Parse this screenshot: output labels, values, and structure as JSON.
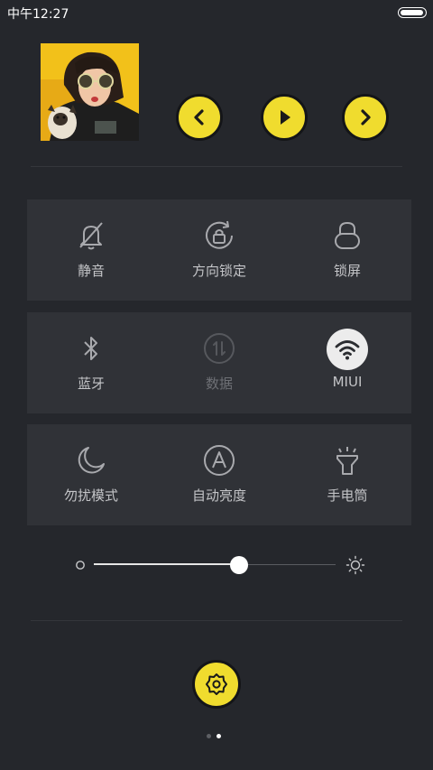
{
  "status_bar": {
    "time": "中午12:27",
    "battery_level": 1.0
  },
  "media": {
    "album_art": "album-cover-photo",
    "controls": [
      "previous-icon",
      "play-icon",
      "next-icon"
    ],
    "accent_color": "#f0dc2e"
  },
  "toggles": {
    "row1": [
      {
        "label": "静音",
        "icon": "mute-bell-icon",
        "active": false
      },
      {
        "label": "方向锁定",
        "icon": "rotation-lock-icon",
        "active": false
      },
      {
        "label": "锁屏",
        "icon": "lock-screen-icon",
        "active": false
      }
    ],
    "row2": [
      {
        "label": "蓝牙",
        "icon": "bluetooth-icon",
        "active": false
      },
      {
        "label": "数据",
        "icon": "mobile-data-icon",
        "active": false,
        "disabled": true
      },
      {
        "label": "MIUI",
        "icon": "wifi-icon",
        "active": true
      }
    ],
    "row3": [
      {
        "label": "勿扰模式",
        "icon": "do-not-disturb-moon-icon",
        "active": false
      },
      {
        "label": "自动亮度",
        "icon": "auto-brightness-icon",
        "active": false
      },
      {
        "label": "手电筒",
        "icon": "flashlight-icon",
        "active": false
      }
    ]
  },
  "brightness": {
    "level": 0.6,
    "low_icon": "brightness-low-icon",
    "high_icon": "brightness-high-icon"
  },
  "settings": {
    "icon": "settings-gear-icon"
  },
  "pager": {
    "count": 2,
    "active_index": 1
  }
}
